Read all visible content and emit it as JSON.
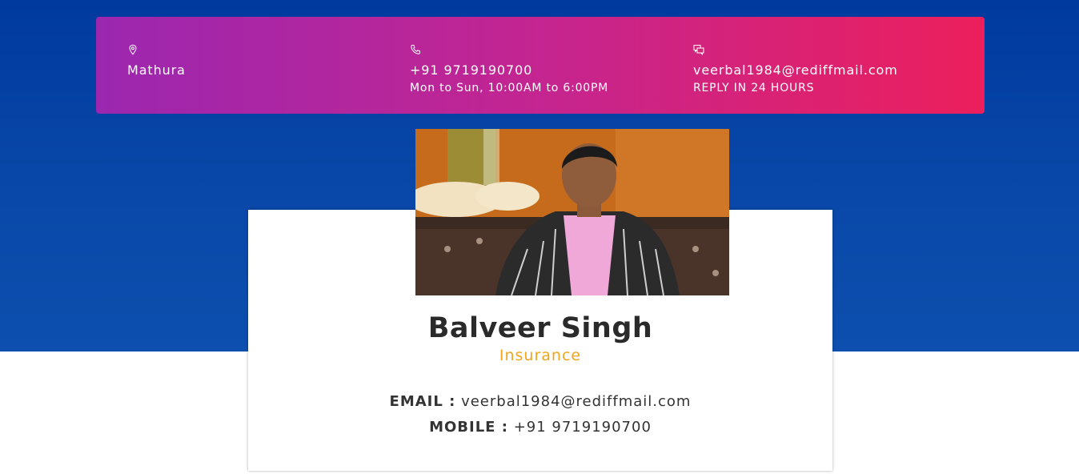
{
  "contact_bar": {
    "location": {
      "icon": "map-pin-icon",
      "text": "Mathura"
    },
    "phone": {
      "icon": "phone-icon",
      "number": "+91 9719190700",
      "hours": "Mon to Sun, 10:00AM to 6:00PM"
    },
    "email": {
      "icon": "chat-bubbles-icon",
      "address": "veerbal1984@rediffmail.com",
      "note": "REPLY IN 24 HOURS"
    }
  },
  "profile": {
    "photo_alt": "Balveer Singh",
    "name": "Balveer Singh",
    "role": "Insurance",
    "email_label": "EMAIL :",
    "email_value": "veerbal1984@rediffmail.com",
    "mobile_label": "MOBILE :",
    "mobile_value": "+91 9719190700"
  },
  "colors": {
    "hero_blue": "#003a9f",
    "bar_gradient_start": "#9b27b0",
    "bar_gradient_end": "#ec1f5c",
    "accent_orange": "#f2a51c",
    "text_dark": "#2a2a2a"
  }
}
